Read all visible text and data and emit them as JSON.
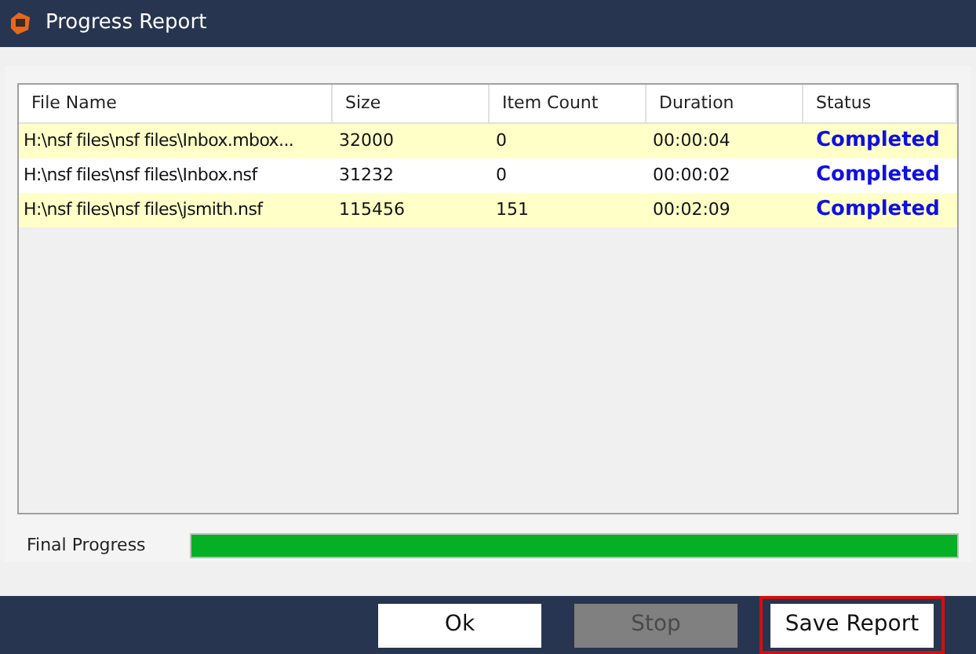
{
  "window": {
    "title": "Progress Report"
  },
  "table": {
    "columns": [
      "File Name",
      "Size",
      "Item Count",
      "Duration",
      "Status"
    ],
    "rows": [
      {
        "cells": [
          "H:\\nsf files\\nsf files\\Inbox.mbox...",
          "32000",
          "0",
          "00:00:04",
          "Completed"
        ]
      },
      {
        "cells": [
          "H:\\nsf files\\nsf files\\Inbox.nsf",
          "31232",
          "0",
          "00:00:02",
          "Completed"
        ]
      },
      {
        "cells": [
          "H:\\nsf files\\nsf files\\jsmith.nsf",
          "115456",
          "151",
          "00:02:09",
          "Completed"
        ]
      }
    ]
  },
  "final_progress": {
    "label": "Final Progress",
    "level": 1
  },
  "buttons": [
    {
      "label": "Ok",
      "disabled": false,
      "highlighted": false
    },
    {
      "label": "Stop",
      "disabled": true,
      "highlighted": false
    },
    {
      "label": "Save Report",
      "disabled": false,
      "highlighted": true
    }
  ]
}
